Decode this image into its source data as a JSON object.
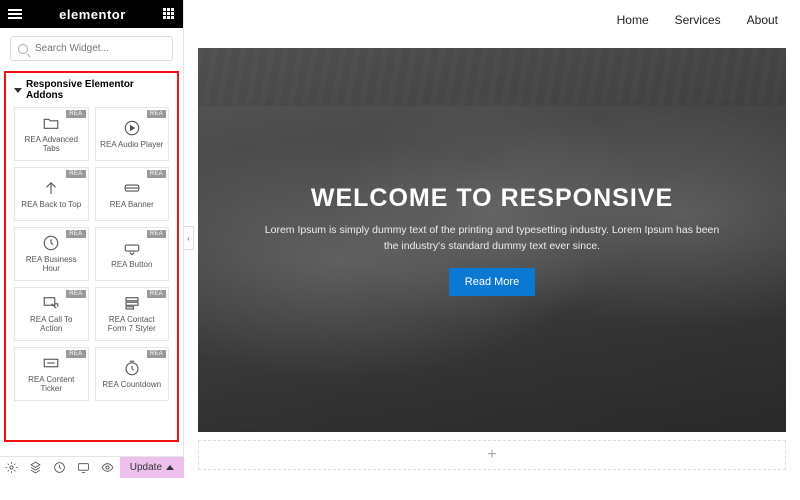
{
  "brand": "elementor",
  "search": {
    "placeholder": "Search Widget..."
  },
  "section": {
    "title": "Responsive Elementor Addons",
    "badge": "REA",
    "widgets": [
      {
        "label": "REA Advanced Tabs",
        "icon": "folder"
      },
      {
        "label": "REA Audio Player",
        "icon": "play"
      },
      {
        "label": "REA Back to Top",
        "icon": "arrowup"
      },
      {
        "label": "REA Banner",
        "icon": "banner"
      },
      {
        "label": "REA Business Hour",
        "icon": "clock"
      },
      {
        "label": "REA Button",
        "icon": "button"
      },
      {
        "label": "REA Call To Action",
        "icon": "cta"
      },
      {
        "label": "REA Contact Form 7 Styler",
        "icon": "form"
      },
      {
        "label": "REA Content Ticker",
        "icon": "ticker"
      },
      {
        "label": "REA Countdown",
        "icon": "countdown"
      }
    ]
  },
  "footer": {
    "update": "Update"
  },
  "nav": {
    "items": [
      "Home",
      "Services",
      "About"
    ]
  },
  "hero": {
    "heading": "WELCOME TO RESPONSIVE",
    "text": "Lorem Ipsum is simply dummy text of the printing and typesetting industry. Lorem Ipsum has been the industry's standard dummy text ever since.",
    "cta": "Read More"
  },
  "add": "+"
}
